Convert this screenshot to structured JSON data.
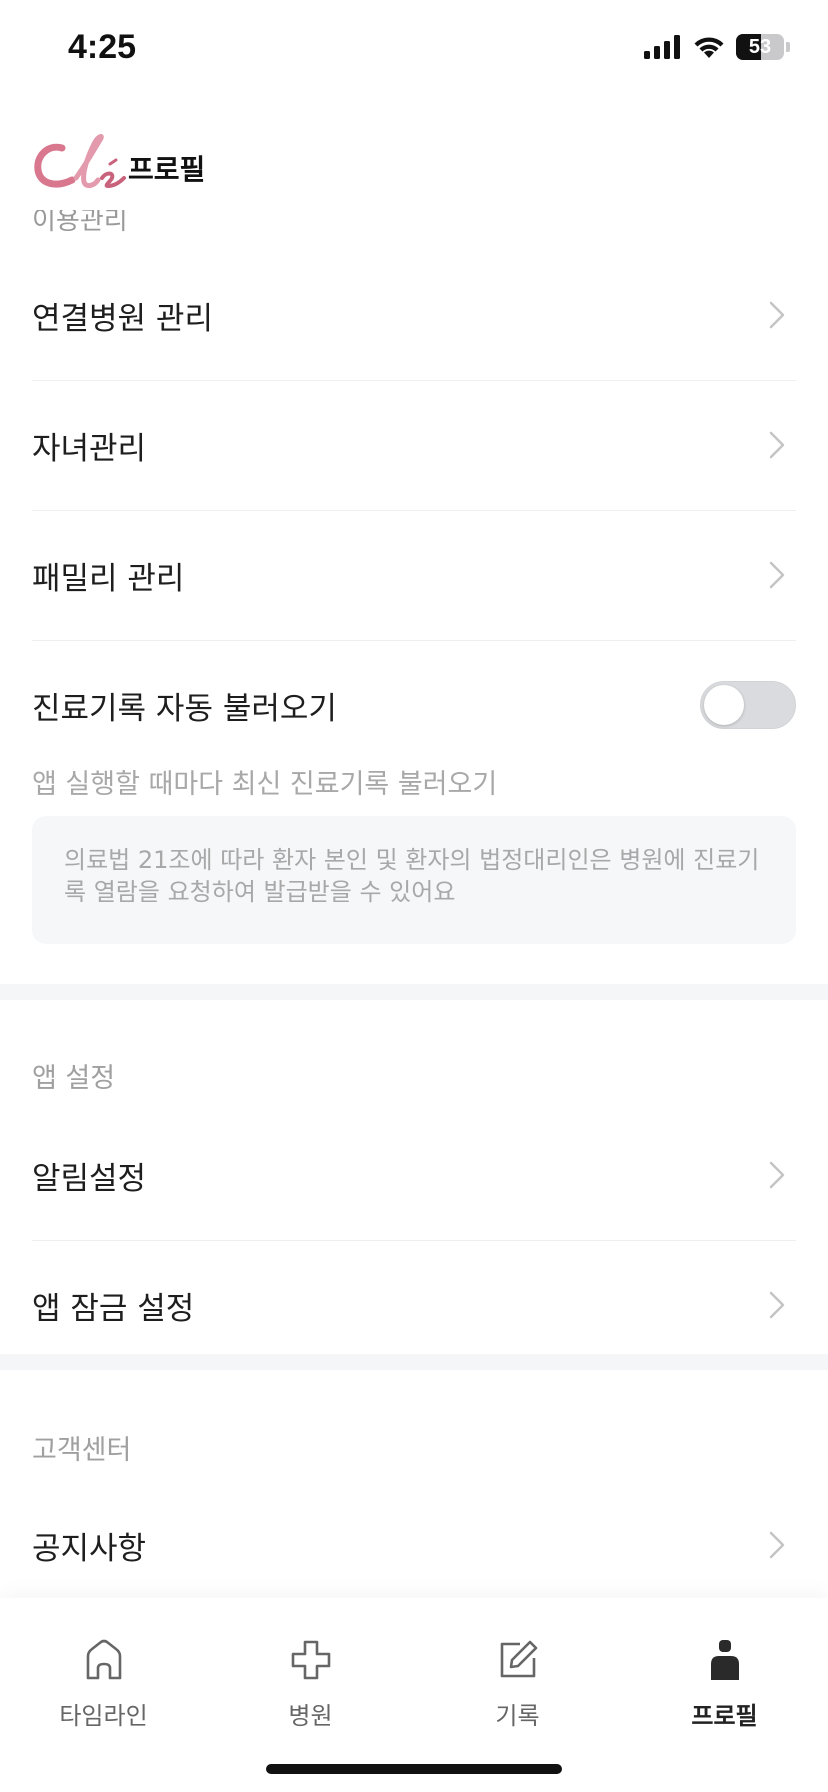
{
  "status_bar": {
    "time": "4:25",
    "battery": "53",
    "battery_level": 0.53
  },
  "header": {
    "logo_text": "Clé",
    "title": "프로필"
  },
  "usage_section": {
    "title": "이용관리",
    "items": [
      {
        "label": "연결병원 관리"
      },
      {
        "label": "자녀관리"
      },
      {
        "label": "패밀리 관리"
      }
    ],
    "auto_records": {
      "label": "진료기록 자동 불러오기",
      "enabled": false,
      "description": "앱 실행할 때마다 최신 진료기록 불러오기",
      "info": "의료법 21조에 따라 환자 본인 및 환자의 법정대리인은 병원에 진료기록 열람을 요청하여 발급받을 수 있어요"
    }
  },
  "app_settings_section": {
    "title": "앱 설정",
    "items": [
      {
        "label": "알림설정"
      },
      {
        "label": "앱 잠금 설정"
      }
    ]
  },
  "customer_center_section": {
    "title": "고객센터",
    "items": [
      {
        "label": "공지사항"
      }
    ]
  },
  "tab_bar": {
    "tabs": [
      {
        "label": "타임라인",
        "icon": "home-icon",
        "active": false
      },
      {
        "label": "병원",
        "icon": "hospital-cross-icon",
        "active": false
      },
      {
        "label": "기록",
        "icon": "edit-icon",
        "active": false
      },
      {
        "label": "프로필",
        "icon": "person-icon",
        "active": true
      }
    ]
  },
  "colors": {
    "logo_pink": "#d9778f",
    "toggle_off": "#dadbde",
    "chevron": "#c4c4c4",
    "muted_text": "#a8a8a8"
  }
}
